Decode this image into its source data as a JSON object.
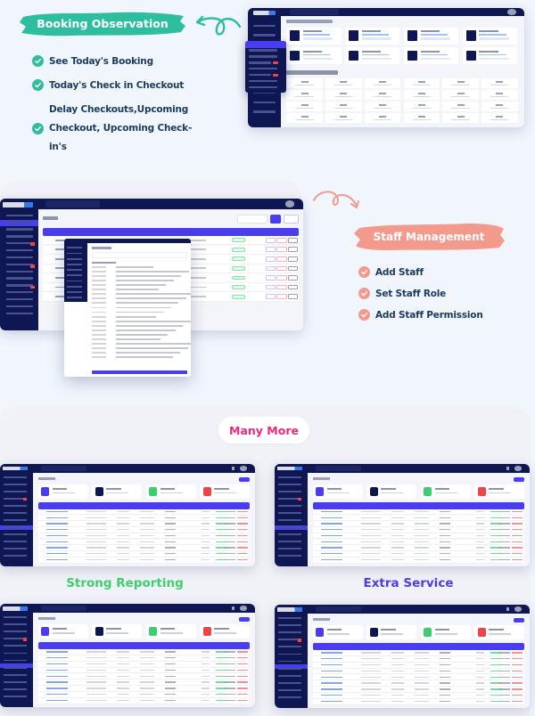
{
  "sections": {
    "booking_observation": {
      "title": "Booking Observation",
      "accent": "#2fbda0",
      "features": [
        "See Today's Booking",
        "Today's Check in Checkout",
        "Delay Checkouts,Upcoming Checkout, Upcoming Check-in's"
      ],
      "feature_lines_third": [
        "Delay Checkouts,Upcoming",
        "Checkout, Upcoming Check-",
        "in's"
      ]
    },
    "staff_management": {
      "title": "Staff Management",
      "accent": "#f39a8c",
      "features": [
        "Add  Staff",
        "Set Staff Role",
        "Add Staff Permission"
      ]
    },
    "many_more": {
      "label": "Many More",
      "label_color": "#f0287a",
      "captions": [
        {
          "text": "Strong Reporting",
          "color": "#3ccf6e"
        },
        {
          "text": "Extra Service",
          "color": "#4a3df0"
        }
      ]
    }
  },
  "colors": {
    "page_bg": "#f1f6fd",
    "panel_bg": "#f1f2f8",
    "app_nav": "#0f1752",
    "app_primary": "#4a3df0",
    "stat_colors": [
      "#4a3df0",
      "#0f1752",
      "#3ccf6e",
      "#ef4444"
    ]
  },
  "screenshots": [
    {
      "name": "booking-dashboard-preview",
      "kind": "room-grid"
    },
    {
      "name": "staff-list-preview",
      "kind": "staff-table"
    },
    {
      "name": "reporting-preview",
      "kind": "booking-table"
    },
    {
      "name": "extra-service-preview",
      "kind": "booking-table"
    },
    {
      "name": "bookings-preview-3",
      "kind": "booking-table"
    },
    {
      "name": "bookings-preview-4",
      "kind": "booking-table"
    }
  ]
}
